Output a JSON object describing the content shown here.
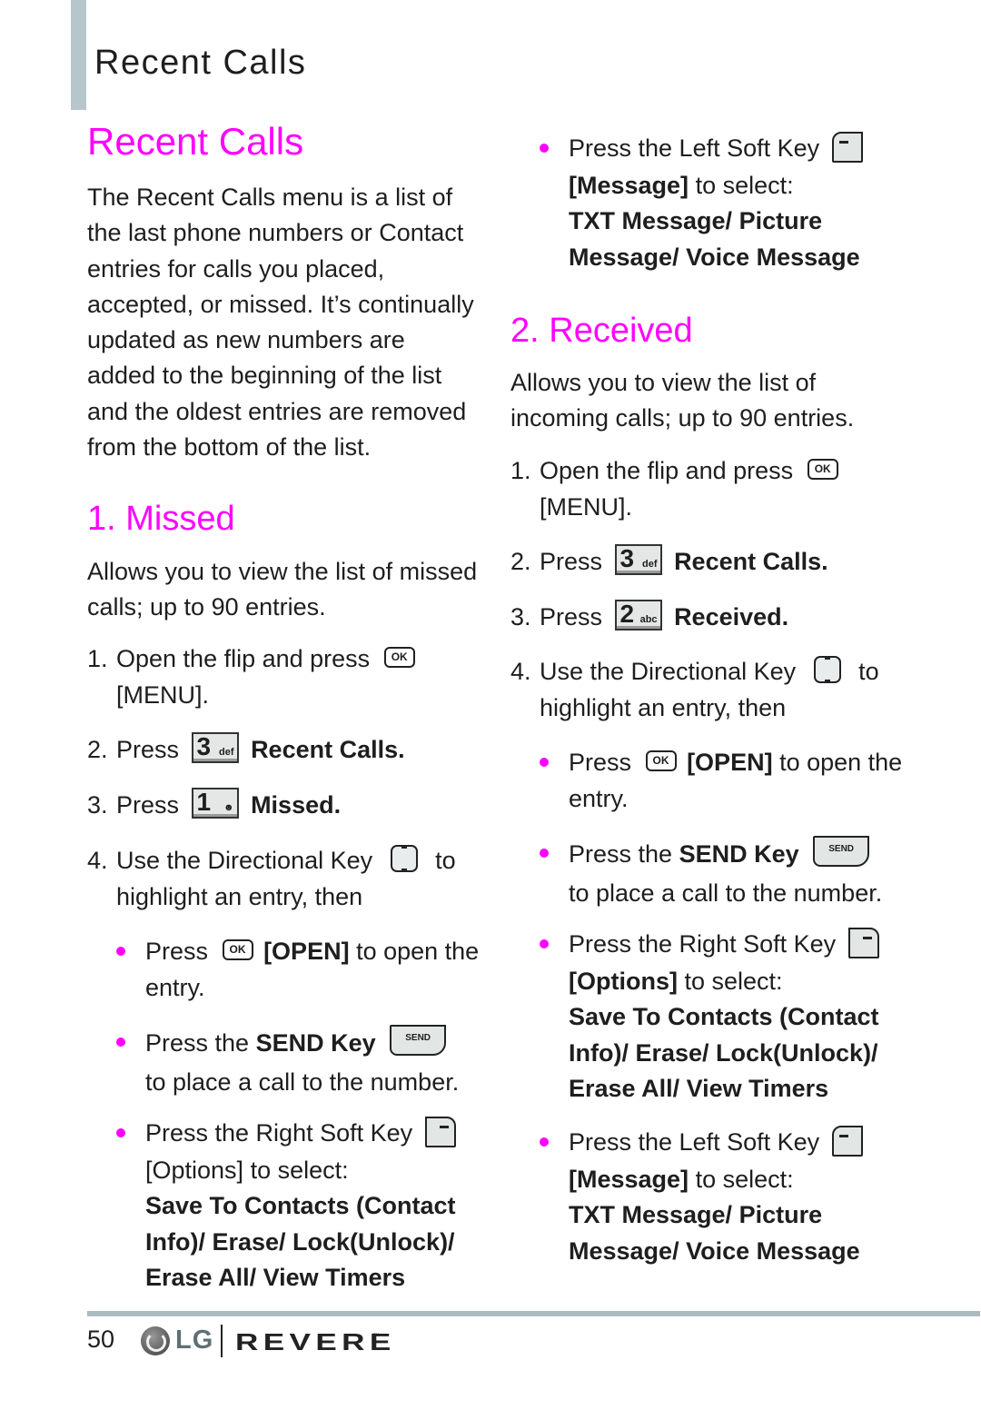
{
  "header": {
    "title": "Recent Calls"
  },
  "page_title": "Recent Calls",
  "intro": "The Recent Calls menu is a list of the last phone numbers or Contact entries for calls you placed, accepted, or missed. It’s continually updated as new numbers are added to the beginning of the list and the oldest entries are removed from the bottom of the list.",
  "colors": {
    "accent": "#ff00ff",
    "header_bar": "#b6c6cb",
    "text": "#1e1e1e"
  },
  "sections": [
    {
      "heading": "1. Missed",
      "description": "Allows you to view the list of missed calls; up to 90 entries.",
      "steps": [
        {
          "num": "1.",
          "pre": "Open the flip and press",
          "icon": "ok-key-icon",
          "icon_label": "OK",
          "post": "[MENU]."
        },
        {
          "num": "2.",
          "pre": "Press",
          "icon": "key-3-icon",
          "icon_big": "3",
          "icon_small": "def",
          "post": "Recent Calls."
        },
        {
          "num": "3.",
          "pre": "Press",
          "icon": "key-1-icon",
          "icon_big": "1",
          "icon_small": "☻",
          "post": "Missed."
        },
        {
          "num": "4.",
          "pre": "Use the Directional Key",
          "icon": "directional-key-icon",
          "post": "to highlight an entry, then"
        }
      ],
      "bullets": [
        {
          "pre": "Press",
          "icon": "ok-key-icon",
          "icon_label": "OK",
          "bold": "[OPEN]",
          "post": "to open the entry."
        },
        {
          "pre": "Press the",
          "bold": "SEND Key",
          "icon": "send-key-icon",
          "icon_label": "SEND",
          "post": "to place a call to the number."
        },
        {
          "pre": "Press the Right Soft Key",
          "icon": "right-soft-key-icon",
          "bold": "[Options]",
          "post": "to select:",
          "options": "Save To Contacts (Contact Info)/ Erase/ Lock(Unlock)/ Erase All/ View Timers"
        },
        {
          "pre": "Press the Left Soft Key",
          "icon": "left-soft-key-icon",
          "bold": "[Message]",
          "post": "to select:",
          "options": "TXT Message/ Picture Message/ Voice Message"
        }
      ]
    },
    {
      "heading": "2. Received",
      "description": "Allows you to view the list of incoming calls; up to 90 entries.",
      "steps": [
        {
          "num": "1.",
          "pre": "Open the flip and press",
          "icon": "ok-key-icon",
          "icon_label": "OK",
          "post": "[MENU]."
        },
        {
          "num": "2.",
          "pre": "Press",
          "icon": "key-3-icon",
          "icon_big": "3",
          "icon_small": "def",
          "post": "Recent Calls."
        },
        {
          "num": "3.",
          "pre": "Press",
          "icon": "key-2-icon",
          "icon_big": "2",
          "icon_small": "abc",
          "post": "Received."
        },
        {
          "num": "4.",
          "pre": "Use the Directional Key",
          "icon": "directional-key-icon",
          "post": "to highlight an entry, then"
        }
      ],
      "bullets": [
        {
          "pre": "Press",
          "icon": "ok-key-icon",
          "icon_label": "OK",
          "bold": "[OPEN]",
          "post": "to open the entry."
        },
        {
          "pre": "Press the",
          "bold": "SEND Key",
          "icon": "send-key-icon",
          "icon_label": "SEND",
          "post": "to place a call to the number."
        },
        {
          "pre": "Press the Right Soft Key",
          "icon": "right-soft-key-icon",
          "bold": "[Options]",
          "post": "to select:",
          "options": "Save To Contacts (Contact Info)/ Erase/ Lock(Unlock)/ Erase All/ View Timers"
        },
        {
          "pre": "Press the Left Soft Key",
          "icon": "left-soft-key-icon",
          "bold": "[Message]",
          "post": "to select:",
          "options": "TXT Message/ Picture Message/ Voice Message"
        }
      ]
    }
  ],
  "footer": {
    "page_number": "50",
    "lg_text": "LG",
    "brand": "REVERE",
    "trademark": "™"
  }
}
